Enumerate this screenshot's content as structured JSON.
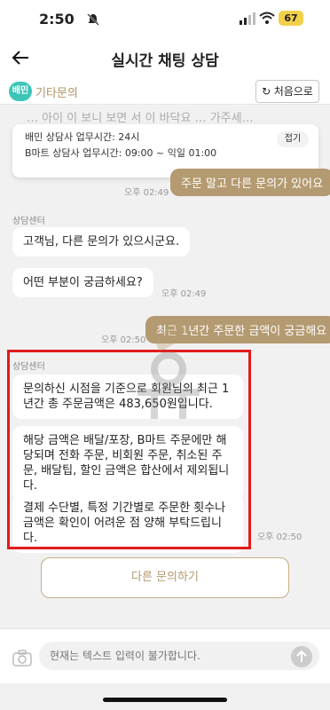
{
  "status": {
    "time": "2:50",
    "battery": "67"
  },
  "header": {
    "title": "실시간 채팅 상담"
  },
  "subheader": {
    "brand": "배민",
    "category": "기타문의",
    "restart_label": "처음으로",
    "restart_icon": "↻"
  },
  "chat": {
    "faded_line": "… 아이 이 보니 보면 서 이 바닥요 … 가주세…",
    "hours_card": {
      "line1": "배민 상담사 업무시간: 24시",
      "line2": "B마트 상담사 업무시간: 09:00 ~ 익일 01:00",
      "collapse_label": "접기"
    },
    "messages": [
      {
        "time": "오후 02:49",
        "text": "주문 말고 다른 문의가 있어요"
      },
      {
        "sender": "상담센터",
        "text": "고객님, 다른 문의가 있으시군요."
      },
      {
        "text": "어떤 부분이 궁금하세요?",
        "time": "오후 02:49"
      },
      {
        "time": "오후 02:50",
        "text": "최근 1년간 주문한 금액이 궁금해요"
      },
      {
        "sender": "상담센터",
        "text": "문의하신 시점을 기준으로 회원님의 최근 1년간 총 주문금액은 483,650원입니다."
      },
      {
        "text": "해당 금액은 배달/포장, B마트 주문에만 해당되며 전화 주문, 비회원 주문, 취소된 주문, 배달팁, 할인 금액은 합산에서 제외됩니다."
      },
      {
        "text": "결제 수단별, 특정 기간별로 주문한 횟수나 금액은 확인이 어려운 점 양해 부탁드립니다.",
        "time": "오후 02:50"
      }
    ],
    "more_button": "다른 문의하기"
  },
  "input": {
    "placeholder": "현재는 텍스트 입력이 불가합니다."
  },
  "colors": {
    "accent": "#b49a70",
    "highlight": "#e11b1b",
    "brand": "#3ec5b8"
  }
}
